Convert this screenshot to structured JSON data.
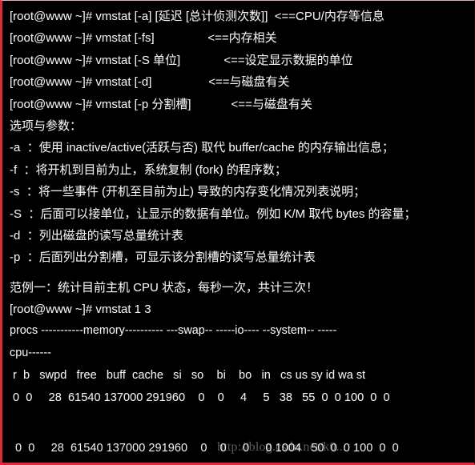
{
  "terminal": {
    "prompt": "[root@www ~]#",
    "border_color": "#d92b3a",
    "background_color": "#000000",
    "text_color": "#f2f2f2"
  },
  "usage_lines": [
    {
      "command": "[root@www ~]# vmstat [-a] [延迟 [总计侦测次数]]",
      "arrow": "<==CPU/内存等信息",
      "arrow_indent": 2
    },
    {
      "command": "[root@www ~]# vmstat [-fs]",
      "arrow": "<==内存相关",
      "arrow_indent": 16
    },
    {
      "command": "[root@www ~]# vmstat [-S 单位]",
      "arrow": "<==设定显示数据的单位",
      "arrow_indent": 13
    },
    {
      "command": "[root@www ~]# vmstat [-d]",
      "arrow": "<==与磁盘有关",
      "arrow_indent": 17
    },
    {
      "command": "[root@www ~]# vmstat [-p 分割槽]",
      "arrow": "<==与磁盘有关",
      "arrow_indent": 12
    }
  ],
  "options": {
    "heading": "选项与参数：",
    "items": [
      {
        "flag": "-a",
        "desc": "：使用 inactive/active(活跃与否) 取代 buffer/cache 的内存输出信息；"
      },
      {
        "flag": "-f",
        "desc": "：将开机到目前为止，系统复制 (fork) 的程序数；"
      },
      {
        "flag": "-s",
        "desc": "：将一些事件 (开机至目前为止) 导致的内存变化情况列表说明；"
      },
      {
        "flag": "-S",
        "desc": "：后面可以接单位，让显示的数据有单位。例如 K/M 取代 bytes 的容量；"
      },
      {
        "flag": "-d",
        "desc": "：列出磁盘的读写总量统计表"
      },
      {
        "flag": "-p",
        "desc": "：后面列出分割槽，可显示该分割槽的读写总量统计表"
      }
    ]
  },
  "example": {
    "title": "范例一：统计目前主机 CPU 状态，每秒一次，共计三次！",
    "command": "[root@www ~]# vmstat 1 3",
    "group_header_line1": "procs -----------memory---------- ---swap-- -----io---- --system-- -----",
    "group_header_line2": "cpu------",
    "column_header": " r  b   swpd   free   buff  cache   si   so    bi    bo   in   cs us sy id wa st",
    "rows": [
      " 0  0     28  61540 137000 291960    0    0     4     5   38   55  0  0 100  0  0",
      " 0  0     28  61540 137000 291960    0    0     0     0 1004   50  0  0 100  0  0"
    ]
  },
  "watermark": {
    "text": "http://blog.csdn.net/k0...",
    "color": "#6b6b6b"
  }
}
